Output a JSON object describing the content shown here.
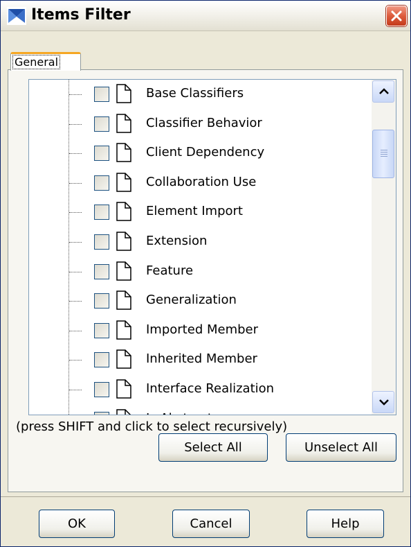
{
  "window": {
    "title": "Items Filter",
    "close_icon": "close-icon"
  },
  "tabs": [
    {
      "label": "General",
      "selected": true
    }
  ],
  "tree": {
    "items": [
      {
        "label": "Base Classifiers",
        "checked": false,
        "icon": "document-icon"
      },
      {
        "label": "Classifier Behavior",
        "checked": false,
        "icon": "document-icon"
      },
      {
        "label": "Client Dependency",
        "checked": false,
        "icon": "document-icon"
      },
      {
        "label": "Collaboration Use",
        "checked": false,
        "icon": "document-icon"
      },
      {
        "label": "Element Import",
        "checked": false,
        "icon": "document-icon"
      },
      {
        "label": "Extension",
        "checked": false,
        "icon": "document-icon"
      },
      {
        "label": "Feature",
        "checked": false,
        "icon": "document-icon"
      },
      {
        "label": "Generalization",
        "checked": false,
        "icon": "document-icon"
      },
      {
        "label": "Imported Member",
        "checked": false,
        "icon": "document-icon"
      },
      {
        "label": "Inherited Member",
        "checked": false,
        "icon": "document-icon"
      },
      {
        "label": "Interface Realization",
        "checked": false,
        "icon": "document-icon"
      },
      {
        "label": "Is Abstract",
        "checked": false,
        "icon": "document-icon"
      }
    ]
  },
  "hint": "(press SHIFT and click to select recursively)",
  "buttons": {
    "select_all": "Select All",
    "unselect_all": "Unselect All",
    "ok": "OK",
    "cancel": "Cancel",
    "help": "Help"
  },
  "colors": {
    "window_bg": "#ece9d8",
    "tab_accent": "#f5a623",
    "close_red": "#dd5b3c",
    "button_border": "#003c74"
  }
}
